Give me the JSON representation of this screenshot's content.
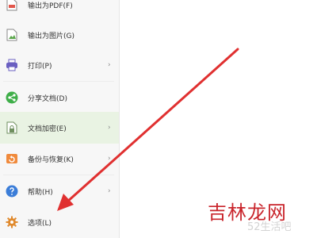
{
  "menu": {
    "items": [
      {
        "label": "输出为PDF(F)",
        "icon": "pdf-export-icon",
        "has_submenu": false
      },
      {
        "label": "输出为图片(G)",
        "icon": "image-export-icon",
        "has_submenu": false
      },
      {
        "label": "打印(P)",
        "icon": "printer-icon",
        "has_submenu": true
      },
      {
        "label": "分享文档(D)",
        "icon": "share-icon",
        "has_submenu": false
      },
      {
        "label": "文档加密(E)",
        "icon": "document-lock-icon",
        "has_submenu": true
      },
      {
        "label": "备份与恢复(K)",
        "icon": "backup-icon",
        "has_submenu": true
      },
      {
        "label": "帮助(H)",
        "icon": "help-icon",
        "has_submenu": true
      },
      {
        "label": "选项(L)",
        "icon": "gear-icon",
        "has_submenu": false
      }
    ],
    "highlighted_index": 4,
    "chevron": "›"
  },
  "watermark": {
    "main": "吉林龙网",
    "sub": "52生活吧"
  },
  "colors": {
    "menu_bg": "#f7f7f7",
    "highlight_bg": "#e9f3e3",
    "arrow": "#e03030",
    "watermark": "#c9242b"
  }
}
